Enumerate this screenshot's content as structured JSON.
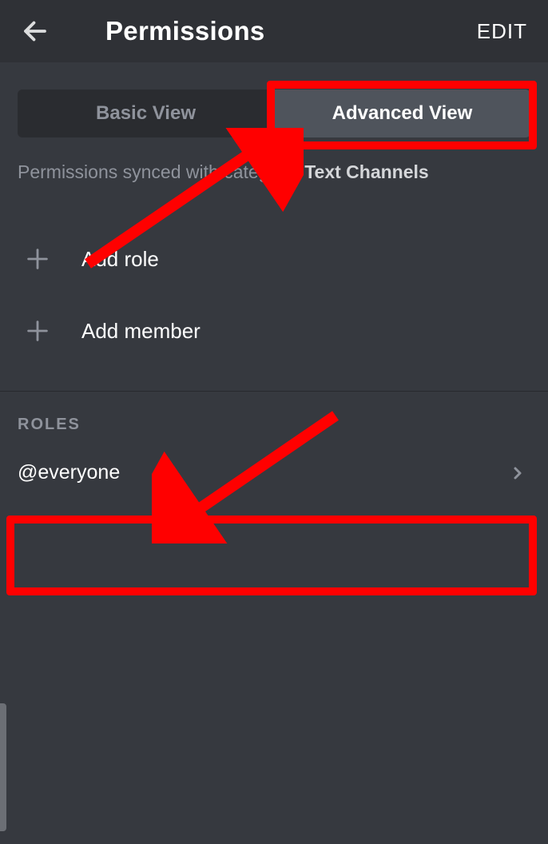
{
  "header": {
    "title": "Permissions",
    "edit_label": "EDIT"
  },
  "tabs": {
    "basic": "Basic View",
    "advanced": "Advanced View"
  },
  "sync": {
    "prefix": "Permissions synced with category: ",
    "category": "Text Channels"
  },
  "add": {
    "role": "Add role",
    "member": "Add member"
  },
  "roles": {
    "heading": "ROLES",
    "items": [
      {
        "name": "@everyone"
      }
    ]
  }
}
